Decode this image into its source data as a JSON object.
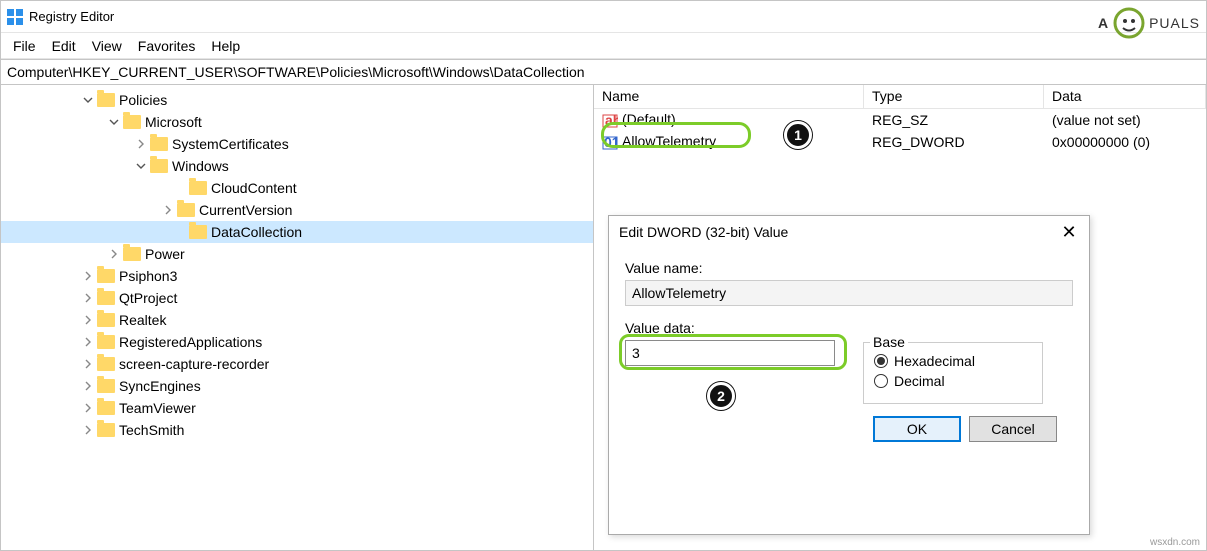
{
  "title": "Registry Editor",
  "menu": [
    "File",
    "Edit",
    "View",
    "Favorites",
    "Help"
  ],
  "address": "Computer\\HKEY_CURRENT_USER\\SOFTWARE\\Policies\\Microsoft\\Windows\\DataCollection",
  "tree": [
    {
      "label": "Policies",
      "indent": 80,
      "twist": "down"
    },
    {
      "label": "Microsoft",
      "indent": 106,
      "twist": "down"
    },
    {
      "label": "SystemCertificates",
      "indent": 133,
      "twist": "right"
    },
    {
      "label": "Windows",
      "indent": 133,
      "twist": "down"
    },
    {
      "label": "CloudContent",
      "indent": 172,
      "twist": ""
    },
    {
      "label": "CurrentVersion",
      "indent": 160,
      "twist": "right"
    },
    {
      "label": "DataCollection",
      "indent": 172,
      "twist": "",
      "selected": true
    },
    {
      "label": "Power",
      "indent": 106,
      "twist": "right"
    },
    {
      "label": "Psiphon3",
      "indent": 80,
      "twist": "right"
    },
    {
      "label": "QtProject",
      "indent": 80,
      "twist": "right"
    },
    {
      "label": "Realtek",
      "indent": 80,
      "twist": "right"
    },
    {
      "label": "RegisteredApplications",
      "indent": 80,
      "twist": "right"
    },
    {
      "label": "screen-capture-recorder",
      "indent": 80,
      "twist": "right"
    },
    {
      "label": "SyncEngines",
      "indent": 80,
      "twist": "right"
    },
    {
      "label": "TeamViewer",
      "indent": 80,
      "twist": "right"
    },
    {
      "label": "TechSmith",
      "indent": 80,
      "twist": "right"
    }
  ],
  "columns": {
    "name": "Name",
    "type": "Type",
    "data": "Data"
  },
  "values": [
    {
      "name": "(Default)",
      "type": "REG_SZ",
      "data": "(value not set)",
      "icon": "sz"
    },
    {
      "name": "AllowTelemetry",
      "type": "REG_DWORD",
      "data": "0x00000000 (0)",
      "icon": "dw"
    }
  ],
  "dialog": {
    "title": "Edit DWORD (32-bit) Value",
    "value_name_label": "Value name:",
    "value_name": "AllowTelemetry",
    "value_data_label": "Value data:",
    "value_data": "3",
    "base_label": "Base",
    "base_hex": "Hexadecimal",
    "base_dec": "Decimal",
    "ok": "OK",
    "cancel": "Cancel"
  },
  "callouts": {
    "one": "1",
    "two": "2"
  },
  "watermark": {
    "brand_left": "A",
    "brand_right": "PUALS"
  },
  "footer": "wsxdn.com"
}
